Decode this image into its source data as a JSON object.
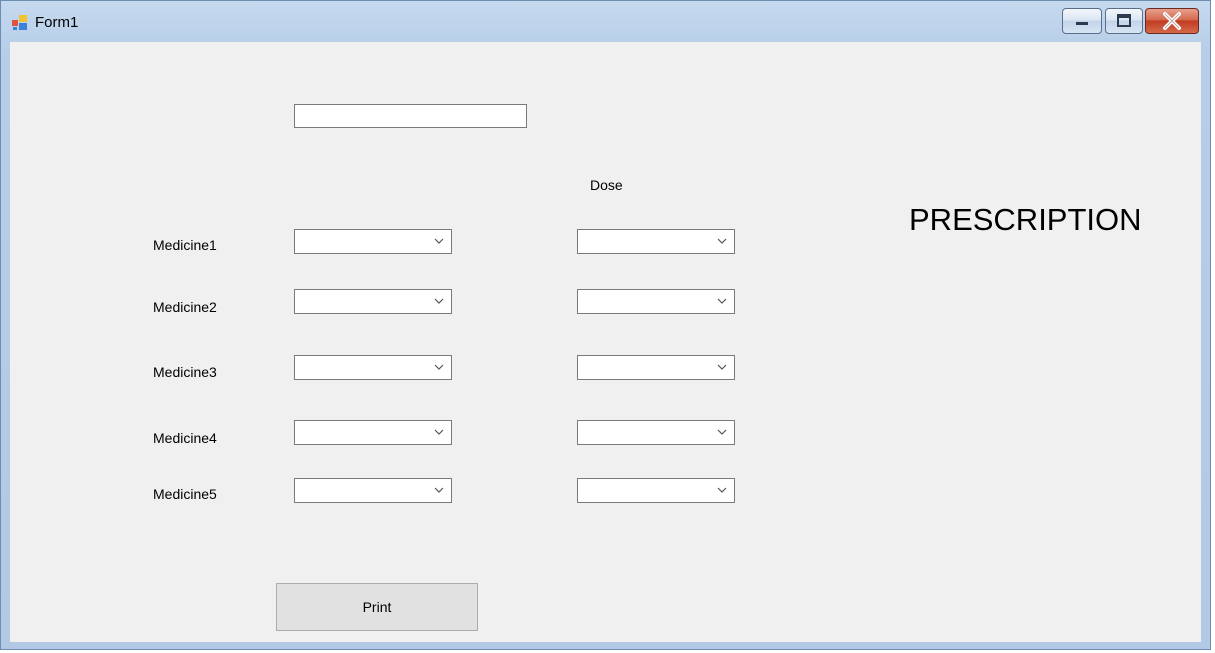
{
  "window": {
    "title": "Form1",
    "icons": {
      "app": "form-app-icon",
      "minimize": "minimize-icon",
      "maximize": "maximize-icon",
      "close": "close-icon"
    }
  },
  "form": {
    "header_label": "PRESCRIPTION",
    "dose_label": "Dose",
    "name_field_value": "",
    "medicines": [
      {
        "label": "Medicine1",
        "medicine_value": "",
        "dose_value": ""
      },
      {
        "label": "Medicine2",
        "medicine_value": "",
        "dose_value": ""
      },
      {
        "label": "Medicine3",
        "medicine_value": "",
        "dose_value": ""
      },
      {
        "label": "Medicine4",
        "medicine_value": "",
        "dose_value": ""
      },
      {
        "label": "Medicine5",
        "medicine_value": "",
        "dose_value": ""
      }
    ],
    "print_button": "Print"
  }
}
